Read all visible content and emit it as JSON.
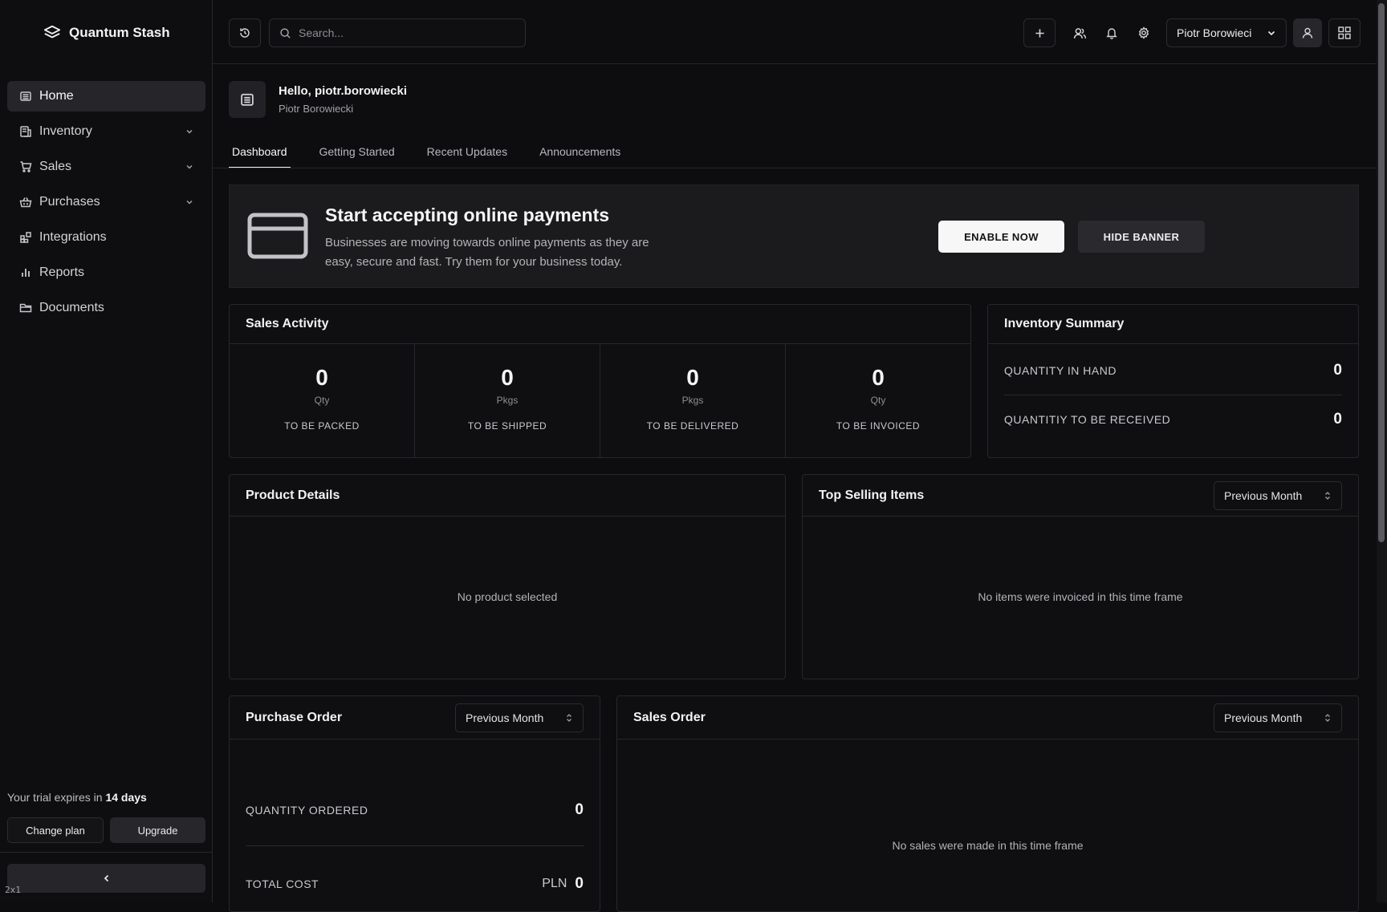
{
  "app": {
    "brand": "Quantum Stash"
  },
  "sidebar": {
    "items": [
      {
        "label": "Home",
        "icon": "home-icon",
        "active": true
      },
      {
        "label": "Inventory",
        "icon": "inventory-icon",
        "expandable": true
      },
      {
        "label": "Sales",
        "icon": "cart-icon",
        "expandable": true
      },
      {
        "label": "Purchases",
        "icon": "basket-icon",
        "expandable": true
      },
      {
        "label": "Integrations",
        "icon": "integrations-icon"
      },
      {
        "label": "Reports",
        "icon": "bar-chart-icon"
      },
      {
        "label": "Documents",
        "icon": "folder-icon"
      }
    ],
    "trial_prefix": "Your trial expires in",
    "trial_days": "14 days",
    "change_plan": "Change plan",
    "upgrade": "Upgrade",
    "scale_badge": "2x1"
  },
  "topbar": {
    "search_placeholder": "Search...",
    "user_name": "Piotr Borowieci"
  },
  "header": {
    "greeting": "Hello, piotr.borowiecki",
    "full_name": "Piotr Borowiecki"
  },
  "tabs": [
    {
      "label": "Dashboard",
      "active": true
    },
    {
      "label": "Getting Started"
    },
    {
      "label": "Recent Updates"
    },
    {
      "label": "Announcements"
    }
  ],
  "banner": {
    "title": "Start accepting online payments",
    "description": "Businesses are moving towards online payments as they are easy, secure and fast. Try them for your business today.",
    "enable": "ENABLE NOW",
    "hide": "HIDE BANNER"
  },
  "sales_activity": {
    "title": "Sales Activity",
    "cells": [
      {
        "value": "0",
        "unit": "Qty",
        "label": "TO BE PACKED"
      },
      {
        "value": "0",
        "unit": "Pkgs",
        "label": "TO BE SHIPPED"
      },
      {
        "value": "0",
        "unit": "Pkgs",
        "label": "TO BE DELIVERED"
      },
      {
        "value": "0",
        "unit": "Qty",
        "label": "TO BE INVOICED"
      }
    ]
  },
  "inventory_summary": {
    "title": "Inventory Summary",
    "rows": [
      {
        "label": "QUANTITY IN HAND",
        "value": "0"
      },
      {
        "label": "QUANTITIY TO BE RECEIVED",
        "value": "0"
      }
    ]
  },
  "product_details": {
    "title": "Product Details",
    "empty": "No product selected"
  },
  "top_selling": {
    "title": "Top Selling Items",
    "period": "Previous Month",
    "empty": "No items were invoiced in this time frame"
  },
  "purchase_order": {
    "title": "Purchase Order",
    "period": "Previous Month",
    "qty_label": "QUANTITY ORDERED",
    "qty_value": "0",
    "cost_label": "TOTAL COST",
    "currency": "PLN",
    "cost_value": "0"
  },
  "sales_order": {
    "title": "Sales Order",
    "period": "Previous Month",
    "empty": "No sales were made in this time frame"
  }
}
